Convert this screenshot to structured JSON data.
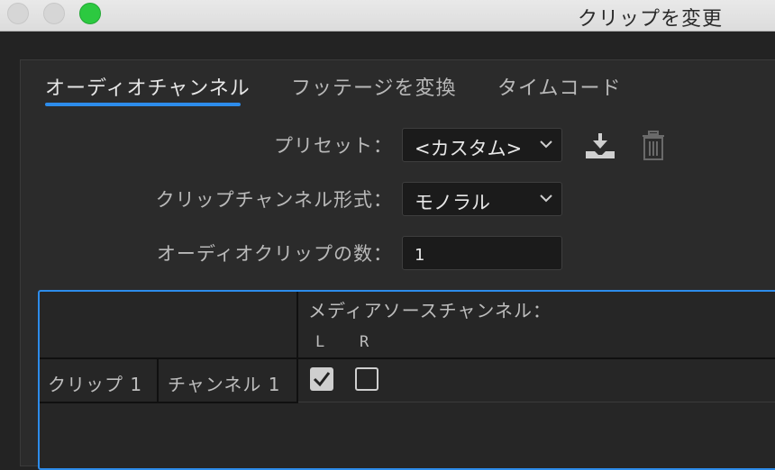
{
  "window": {
    "title": "クリップを変更"
  },
  "tabs": [
    {
      "label": "オーディオチャンネル",
      "active": true
    },
    {
      "label": "フッテージを変換",
      "active": false
    },
    {
      "label": "タイムコード",
      "active": false
    }
  ],
  "form": {
    "preset": {
      "label": "プリセット：",
      "value": "<カスタム>"
    },
    "format": {
      "label": "クリップチャンネル形式：",
      "value": "モノラル"
    },
    "count": {
      "label": "オーディオクリップの数：",
      "value": "1"
    }
  },
  "table": {
    "source_header": "メディアソースチャンネル：",
    "channel_cols": [
      "L",
      "R"
    ],
    "rows": [
      {
        "clip": "クリップ 1",
        "channel": "チャンネル 1",
        "checks": [
          true,
          false
        ]
      }
    ]
  },
  "colors": {
    "accent": "#2d8ceb",
    "zoom_button": "#2cc940"
  }
}
